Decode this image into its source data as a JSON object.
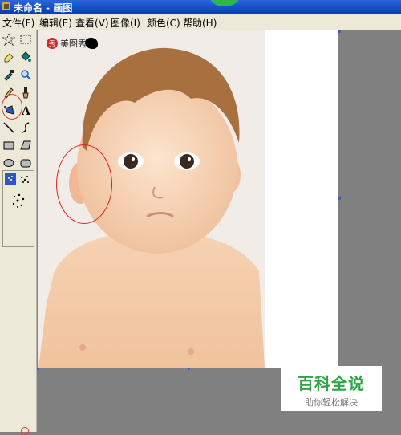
{
  "window": {
    "title": "未命名 - 画图"
  },
  "menu": {
    "file": "文件(F)",
    "edit": "编辑(E)",
    "view": "查看(V)",
    "image": "图像(I)",
    "colors": "颜色(C)",
    "help": "帮助(H)"
  },
  "tools": [
    "free-form-select",
    "select",
    "eraser",
    "fill-with-color",
    "pick-color",
    "magnifier",
    "pencil",
    "brush",
    "airbrush",
    "text",
    "line",
    "curve",
    "rectangle",
    "polygon",
    "ellipse",
    "rounded-rectangle"
  ],
  "watermark": {
    "badge": "秀",
    "text": "美图秀"
  },
  "branding": {
    "title": "百科全说",
    "subtitle": "助你轻松解决"
  },
  "colors": {
    "titlebar": "#0a3cb8",
    "accent_circle": "#e02020",
    "brand_green": "#2fa447"
  }
}
